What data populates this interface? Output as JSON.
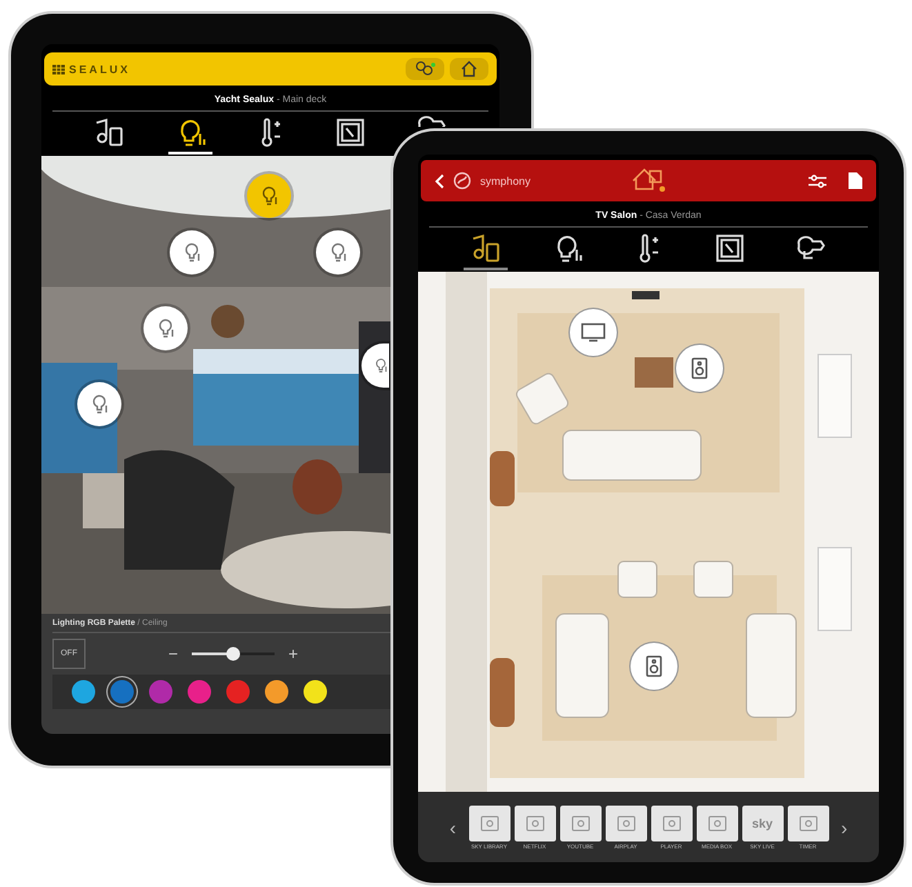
{
  "left_tablet": {
    "brand": "SEALUX",
    "location": {
      "name": "Yacht Sealux",
      "separator": "-",
      "area": "Main deck"
    },
    "tabs": [
      {
        "selected": false
      },
      {
        "selected": true
      },
      {
        "selected": false
      },
      {
        "selected": false
      },
      {
        "selected": false
      }
    ],
    "light_pins": [
      {
        "selected": true
      },
      {
        "selected": false
      },
      {
        "selected": false
      },
      {
        "selected": false
      },
      {
        "selected": false
      },
      {
        "selected": false
      }
    ],
    "panel": {
      "title": "Lighting RGB Palette",
      "separator": "/",
      "subtitle": "Ceiling",
      "off_label": "OFF",
      "minus": "−",
      "plus": "+",
      "level": 0.5,
      "colors": [
        {
          "color": "#1ea6e0",
          "selected": false
        },
        {
          "color": "#1670c0",
          "selected": true
        },
        {
          "color": "#b02aa8",
          "selected": false
        },
        {
          "color": "#e8208a",
          "selected": false
        },
        {
          "color": "#e52222",
          "selected": false
        },
        {
          "color": "#f39a2a",
          "selected": false
        },
        {
          "color": "#f2e21a",
          "selected": false
        }
      ]
    }
  },
  "right_tablet": {
    "brand": "symphony",
    "location": {
      "name": "TV Salon",
      "separator": "-",
      "area": "Casa Verdan"
    },
    "tabs": [
      {
        "selected": true
      },
      {
        "selected": false
      },
      {
        "selected": false
      },
      {
        "selected": false
      },
      {
        "selected": false
      }
    ],
    "devices": [
      {
        "kind": "tv"
      },
      {
        "kind": "speaker"
      },
      {
        "kind": "speaker"
      }
    ],
    "sources": {
      "prev": "‹",
      "next": "›",
      "items": [
        {
          "label": "SKY LIBRARY"
        },
        {
          "label": "NETFLIX"
        },
        {
          "label": "YOUTUBE"
        },
        {
          "label": "AIRPLAY"
        },
        {
          "label": "PLAYER"
        },
        {
          "label": "MEDIA BOX"
        },
        {
          "label": "SKY LIVE",
          "logo": "sky"
        },
        {
          "label": "TIMER"
        }
      ]
    }
  }
}
